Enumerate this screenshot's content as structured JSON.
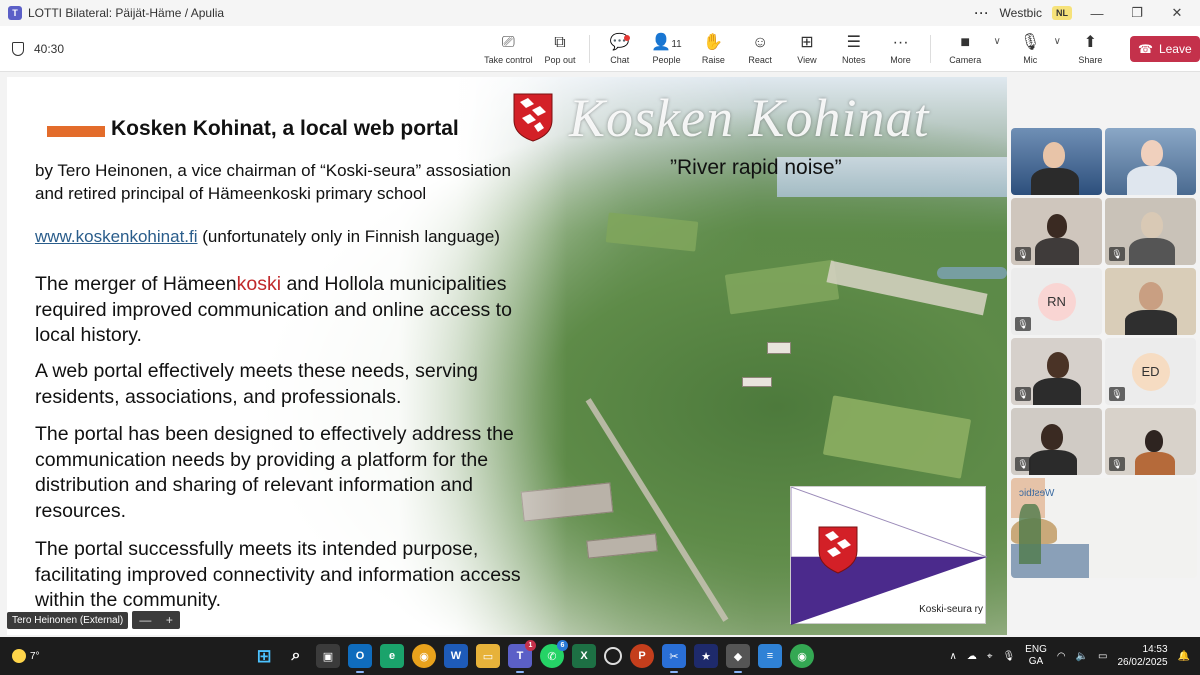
{
  "window": {
    "title": "LOTTI Bilateral: Päijät-Häme / Apulia",
    "org": "Westbic",
    "org_badge": "NL",
    "controls": {
      "more": "···",
      "minimize": "—",
      "restore": "❐",
      "close": "✕"
    }
  },
  "meeting": {
    "timer": "40:30",
    "people_count": "11",
    "toolbar": [
      {
        "id": "take-control",
        "label": "Take control",
        "icon": "take-control-icon"
      },
      {
        "id": "pop-out",
        "label": "Pop out",
        "icon": "pop-out-icon"
      },
      {
        "id": "chat",
        "label": "Chat",
        "icon": "chat-icon"
      },
      {
        "id": "people",
        "label": "People",
        "icon": "people-icon"
      },
      {
        "id": "raise",
        "label": "Raise",
        "icon": "raise-hand-icon"
      },
      {
        "id": "react",
        "label": "React",
        "icon": "react-icon"
      },
      {
        "id": "view",
        "label": "View",
        "icon": "view-icon"
      },
      {
        "id": "notes",
        "label": "Notes",
        "icon": "notes-icon"
      },
      {
        "id": "more",
        "label": "More",
        "icon": "more-icon"
      },
      {
        "id": "camera",
        "label": "Camera",
        "icon": "camera-icon"
      },
      {
        "id": "mic",
        "label": "Mic",
        "icon": "mic-muted-icon"
      },
      {
        "id": "share",
        "label": "Share",
        "icon": "share-icon"
      }
    ],
    "leave_label": "Leave"
  },
  "slide": {
    "title": "Kosken Kohinat, a local web portal",
    "brand_title": "Kosken Kohinat",
    "brand_subtitle": "”River rapid noise”",
    "author_line1": "by Tero Heinonen, a vice chairman of “Koski-seura” assosiation",
    "author_line2": "and retired principal of Hämeenkoski primary school",
    "url": "www.koskenkohinat.fi",
    "url_note": " (unfortunately only in Finnish language)",
    "p1_prefix": "The merger of Hämeen",
    "p1_highlight": "koski",
    "p1_rest": " and Hollola municipalities required improved communication and online access to local history.",
    "p2": "A web portal effectively meets these needs, serving residents, associations, and professionals.",
    "p3": "The portal has been designed to effectively address the communication needs by providing a platform for the distribution and sharing of relevant information and resources.",
    "p4": "The portal successfully meets its intended purpose, facilitating improved connectivity and information access within the community.",
    "flag_caption": "Koski-seura ry",
    "colors": {
      "accent": "#e36c2b",
      "highlight": "#c0292b",
      "flag_purple": "#4b2a8c",
      "crest_red": "#d32027"
    }
  },
  "presenter": {
    "name": "Tero Heinonen (External)",
    "zoom_out": "—",
    "zoom_in": "+"
  },
  "participants": [
    {
      "initials": "",
      "muted": false
    },
    {
      "initials": "",
      "muted": false
    },
    {
      "initials": "",
      "muted": true
    },
    {
      "initials": "",
      "muted": true
    },
    {
      "initials": "RN",
      "muted": true
    },
    {
      "initials": "",
      "muted": false
    },
    {
      "initials": "",
      "muted": true
    },
    {
      "initials": "ED",
      "muted": true
    },
    {
      "initials": "",
      "muted": true
    },
    {
      "initials": "",
      "muted": true
    },
    {
      "initials": "",
      "muted": true
    }
  ],
  "self_view_label": "Westbic",
  "taskbar": {
    "temperature": "7°",
    "teams_badge": "1",
    "whatsapp_badge": "6",
    "language": "ENG",
    "region": "GA",
    "time": "14:53",
    "date": "26/02/2025"
  }
}
